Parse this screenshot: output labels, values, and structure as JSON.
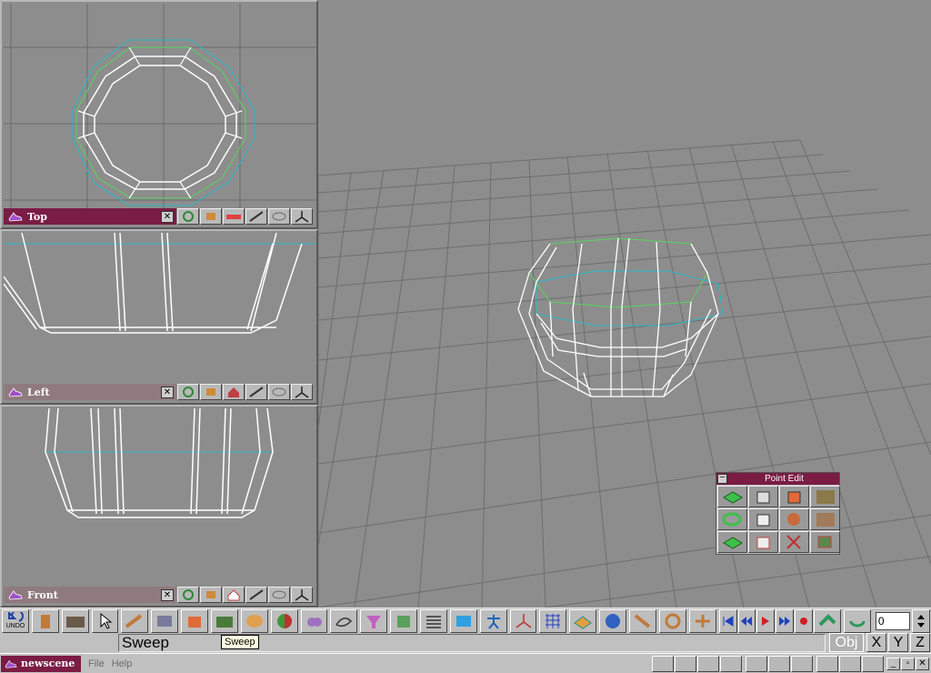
{
  "views": [
    {
      "label": "Top",
      "active": true
    },
    {
      "label": "Left",
      "active": false
    },
    {
      "label": "Front",
      "active": false
    }
  ],
  "view_close_glyph": "✕",
  "point_edit": {
    "title": "Point Edit",
    "min_glyph": "–"
  },
  "toolbar": {
    "undo_label": "UNDO",
    "frame_value": "0"
  },
  "status": {
    "text": "Sweep",
    "tooltip": "Sweep",
    "obj_label": "Obj",
    "axes": [
      "X",
      "Y",
      "Z"
    ]
  },
  "taskbar": {
    "scene": "newscene",
    "menu": [
      "File",
      "Help"
    ],
    "win_glyphs": [
      "_",
      "▫",
      "✕"
    ]
  },
  "colors": {
    "accent": "#7a1c44",
    "viewport": "#8d8d8d",
    "wire": "#ffffff",
    "cyan": "#29b8c8",
    "green": "#59d45e"
  }
}
